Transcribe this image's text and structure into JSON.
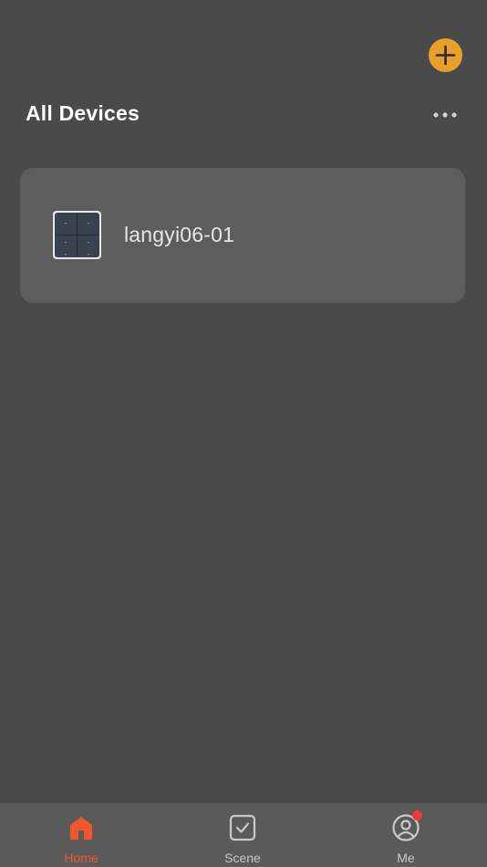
{
  "header": {
    "title": "All Devices",
    "add_icon": "plus-icon",
    "more_icon": "ellipsis-icon"
  },
  "devices": [
    {
      "name": "langyi06-01",
      "icon": "switch-panel-icon"
    }
  ],
  "tabbar": {
    "tabs": [
      {
        "label": "Home",
        "icon": "home-icon",
        "active": true
      },
      {
        "label": "Scene",
        "icon": "scene-check-icon",
        "active": false
      },
      {
        "label": "Me",
        "icon": "user-icon",
        "active": false,
        "badge": true
      }
    ]
  },
  "colors": {
    "accent": "#e8a02a",
    "active_tab": "#f2562c",
    "badge": "#f03a3a",
    "background": "#4a4a4a",
    "card": "#5d5d5d"
  }
}
